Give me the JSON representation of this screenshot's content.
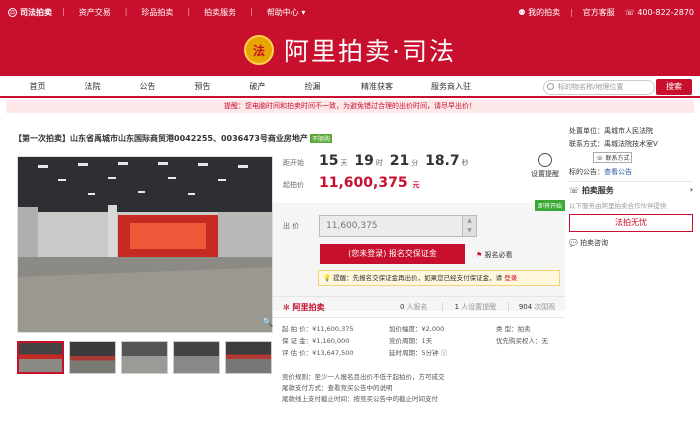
{
  "topbar": {
    "logo": "司法拍卖",
    "nav": [
      "资产交易",
      "珍品拍卖",
      "拍卖服务",
      "帮助中心 ▾"
    ],
    "my_auction": "我的拍卖",
    "service": "官方客服",
    "phone": "400-822-2870"
  },
  "banner": {
    "emblem": "法",
    "title": "阿里拍卖·司法"
  },
  "mainnav": {
    "items": [
      "首页",
      "法院",
      "公告",
      "预告",
      "破产",
      "捡漏",
      "精准获客",
      "服务商入驻"
    ],
    "search_placeholder": "标的物名称/地理位置",
    "search_btn": "搜索"
  },
  "notice": "提醒：您电脑时间和拍卖时间不一致，为避免错过合理的出价时间，请尽早出价！",
  "lot": {
    "title": "【第一次拍卖】山东省禹城市山东国际商贸港0042255、0036473号商业房地产",
    "tag": "不限购"
  },
  "auction": {
    "countdown_label": "距开始",
    "days": "15",
    "days_u": "天",
    "hours": "19",
    "hours_u": "时",
    "mins": "21",
    "mins_u": "分",
    "secs": "18.7",
    "secs_u": "秒",
    "start_price_label": "起拍价",
    "start_price": "11,600,375",
    "price_unit": "元",
    "remind": "设置提醒",
    "soon": "即将开始",
    "bid_label": "出 价",
    "bid_value": "11,600,375",
    "stepper_up": "▲",
    "stepper_down": "▼",
    "register_btn": "(您未登录) 报名交保证金",
    "must_read": "报名必看",
    "tip": "提醒：先报名交保证金再出价，如果您已经支付保证金，请 ",
    "tip_login": "登录"
  },
  "stats": {
    "brand": "阿里拍卖",
    "signed": "0",
    "signed_u": "人报名",
    "reminders": "1",
    "reminders_u": "人设置提醒",
    "views": "904",
    "views_u": "次围观"
  },
  "details": {
    "col1": [
      "起 拍 价：¥11,600,375",
      "保 证 金：¥1,160,000",
      "评 估 价：¥13,647,500"
    ],
    "col2": [
      "加价幅度：¥2,000",
      "竞价周期：1天",
      "延时周期：5分钟 ⓘ"
    ],
    "col3": [
      "类    型：拍卖",
      "优先购买权人：无"
    ]
  },
  "rules": [
    "竞价规则：至少一人报名且出价不低于起拍价，方可成交",
    "尾款支付方式：查看竞买公告中的说明",
    "尾款线上支付截止时间：按竞买公告中的截止时间支付"
  ],
  "right": {
    "court": "处置单位：禹城市人民法院",
    "contact": "联系方式：禹城法院技术室V",
    "contact_btn": "联系方式",
    "announcement": "标的公告：",
    "announcement_link": "查看公告",
    "service_title": "拍卖服务",
    "service_arrow": "›",
    "service_desc": "以下服务由阿里拍卖合作伙伴提供",
    "service_btn": "法拍无忧",
    "consult": "拍卖咨询"
  }
}
